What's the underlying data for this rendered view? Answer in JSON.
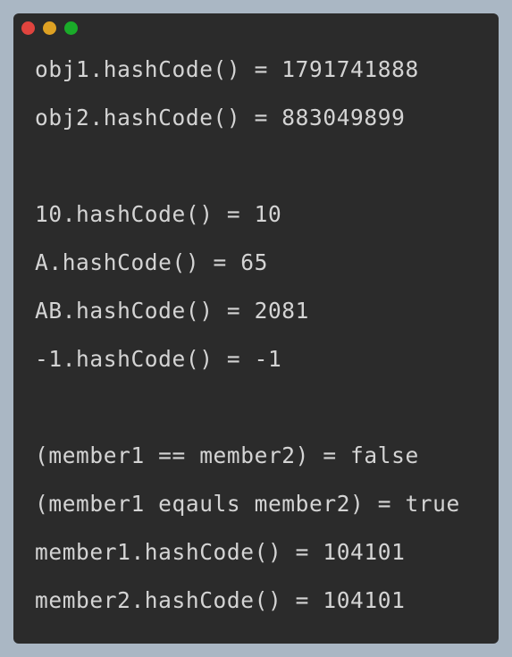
{
  "window": {
    "controls": [
      {
        "name": "close",
        "color": "#e0443e"
      },
      {
        "name": "minimize",
        "color": "#dea123"
      },
      {
        "name": "zoom",
        "color": "#1aab29"
      }
    ]
  },
  "console": {
    "lines": [
      "obj1.hashCode() = 1791741888",
      "obj2.hashCode() = 883049899",
      "",
      "10.hashCode() = 10",
      "A.hashCode() = 65",
      "AB.hashCode() = 2081",
      "-1.hashCode() = -1",
      "",
      "(member1 == member2) = false",
      "(member1 eqauls member2) = true",
      "member1.hashCode() = 104101",
      "member2.hashCode() = 104101"
    ]
  }
}
